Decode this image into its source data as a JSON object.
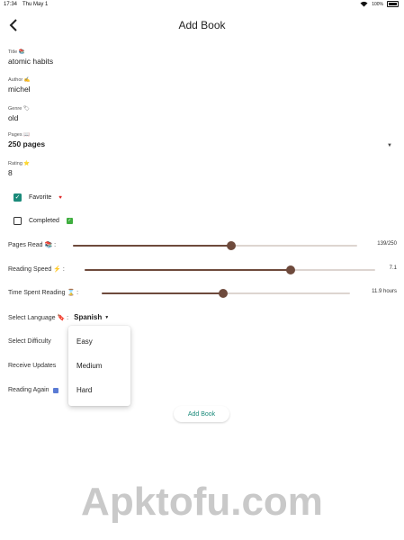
{
  "status_bar": {
    "time": "17:34",
    "date": "Thu May 1"
  },
  "header": {
    "title": "Add Book"
  },
  "form": {
    "title": {
      "label": "Title 📚",
      "value": "atomic habits"
    },
    "author": {
      "label": "Author ✍",
      "value": "michel"
    },
    "genre": {
      "label": "Genre 🏷",
      "value": "old"
    },
    "pages": {
      "label": "Pages 📖",
      "value": "250 pages"
    },
    "rating": {
      "label": "Rating ⭐",
      "value": "8"
    },
    "favorite": {
      "label": "Favorite",
      "checked": true
    },
    "completed": {
      "label": "Completed",
      "checked": false
    }
  },
  "sliders": {
    "pages_read": {
      "label": "Pages Read 📚 :",
      "value_text": "139/250",
      "fraction": 0.556
    },
    "reading_speed": {
      "label": "Reading Speed ⚡ :",
      "value_text": "7.1",
      "fraction": 0.71
    },
    "time_spent": {
      "label": "Time Spent Reading ⌛ :",
      "value_text": "11.9 hours",
      "fraction": 0.49
    }
  },
  "options": {
    "language": {
      "label": "Select Language 🔖 :",
      "selected": "Spanish"
    },
    "difficulty": {
      "label": "Select Difficulty"
    },
    "receive_updates": {
      "label": "Receive Updates"
    },
    "reading_again": {
      "label": "Reading Again"
    }
  },
  "difficulty_menu": {
    "items": [
      "Easy",
      "Medium",
      "Hard"
    ]
  },
  "actions": {
    "add_book": "Add Book"
  },
  "watermark": "Apktofu.com",
  "colors": {
    "accent": "#1a8a7a",
    "slider": "#6e4a3c",
    "slider_track": "#ddd5d0"
  }
}
